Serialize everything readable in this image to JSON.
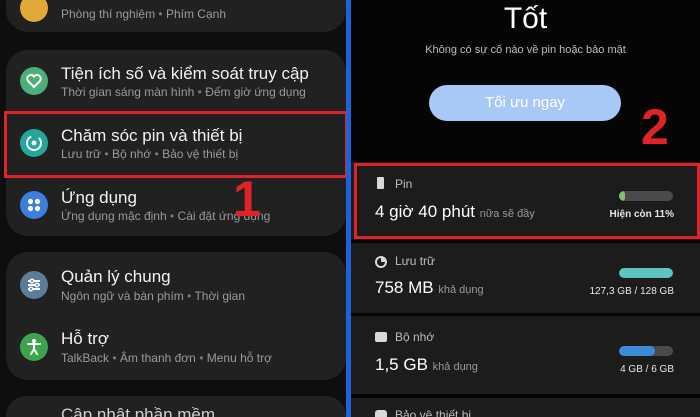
{
  "left": {
    "top_item": {
      "subtitle": [
        "Phòng thí nghiệm",
        "Phím Cạnh"
      ]
    },
    "items": [
      {
        "title": "Tiện ích số và kiểm soát truy cập",
        "subtitle": [
          "Thời gian sáng màn hình",
          "Đếm giờ ứng dụng"
        ],
        "icon": "digital-wellbeing-icon",
        "color": "#4caf7a"
      },
      {
        "title": "Chăm sóc pin và thiết bị",
        "subtitle": [
          "Lưu trữ",
          "Bộ nhớ",
          "Bảo vệ thiết bị"
        ],
        "icon": "device-care-icon",
        "color": "#26a69a"
      },
      {
        "title": "Ứng dụng",
        "subtitle": [
          "Ứng dụng mặc định",
          "Cài đặt ứng dụng"
        ],
        "icon": "apps-icon",
        "color": "#3d7ddb"
      },
      {
        "title": "Quản lý chung",
        "subtitle": [
          "Ngôn ngữ và bàn phím",
          "Thời gian"
        ],
        "icon": "general-management-icon",
        "color": "#5c7d99"
      },
      {
        "title": "Hỗ trợ",
        "subtitle": [
          "TalkBack",
          "Âm thanh đơn",
          "Menu hỗ trợ"
        ],
        "icon": "accessibility-icon",
        "color": "#3fa34d"
      }
    ],
    "bottom_partial": "Cập nhật phần mềm",
    "annotation": "1"
  },
  "right": {
    "status": "Tốt",
    "status_sub": "Không có sự cố nào về pin hoặc bảo mật",
    "optimize_button": "Tối ưu ngay",
    "annotation": "2",
    "battery": {
      "label": "Pin",
      "value": "4 giờ 40 phút",
      "suffix": "nữa sẽ đầy",
      "remaining": "Hiện còn 11%",
      "level": 0.11,
      "color": "#7dc36b"
    },
    "storage": {
      "label": "Lưu trữ",
      "value": "758 MB",
      "suffix": "khả dụng",
      "usage": "127,3 GB / 128 GB",
      "level": 0.995,
      "color": "#5fc4be"
    },
    "memory": {
      "label": "Bộ nhớ",
      "value": "1,5 GB",
      "suffix": "khả dụng",
      "usage": "4 GB / 6 GB",
      "level": 0.67,
      "color": "#3f8ad6"
    },
    "device_protection": {
      "label": "Bảo vệ thiết bị"
    }
  }
}
